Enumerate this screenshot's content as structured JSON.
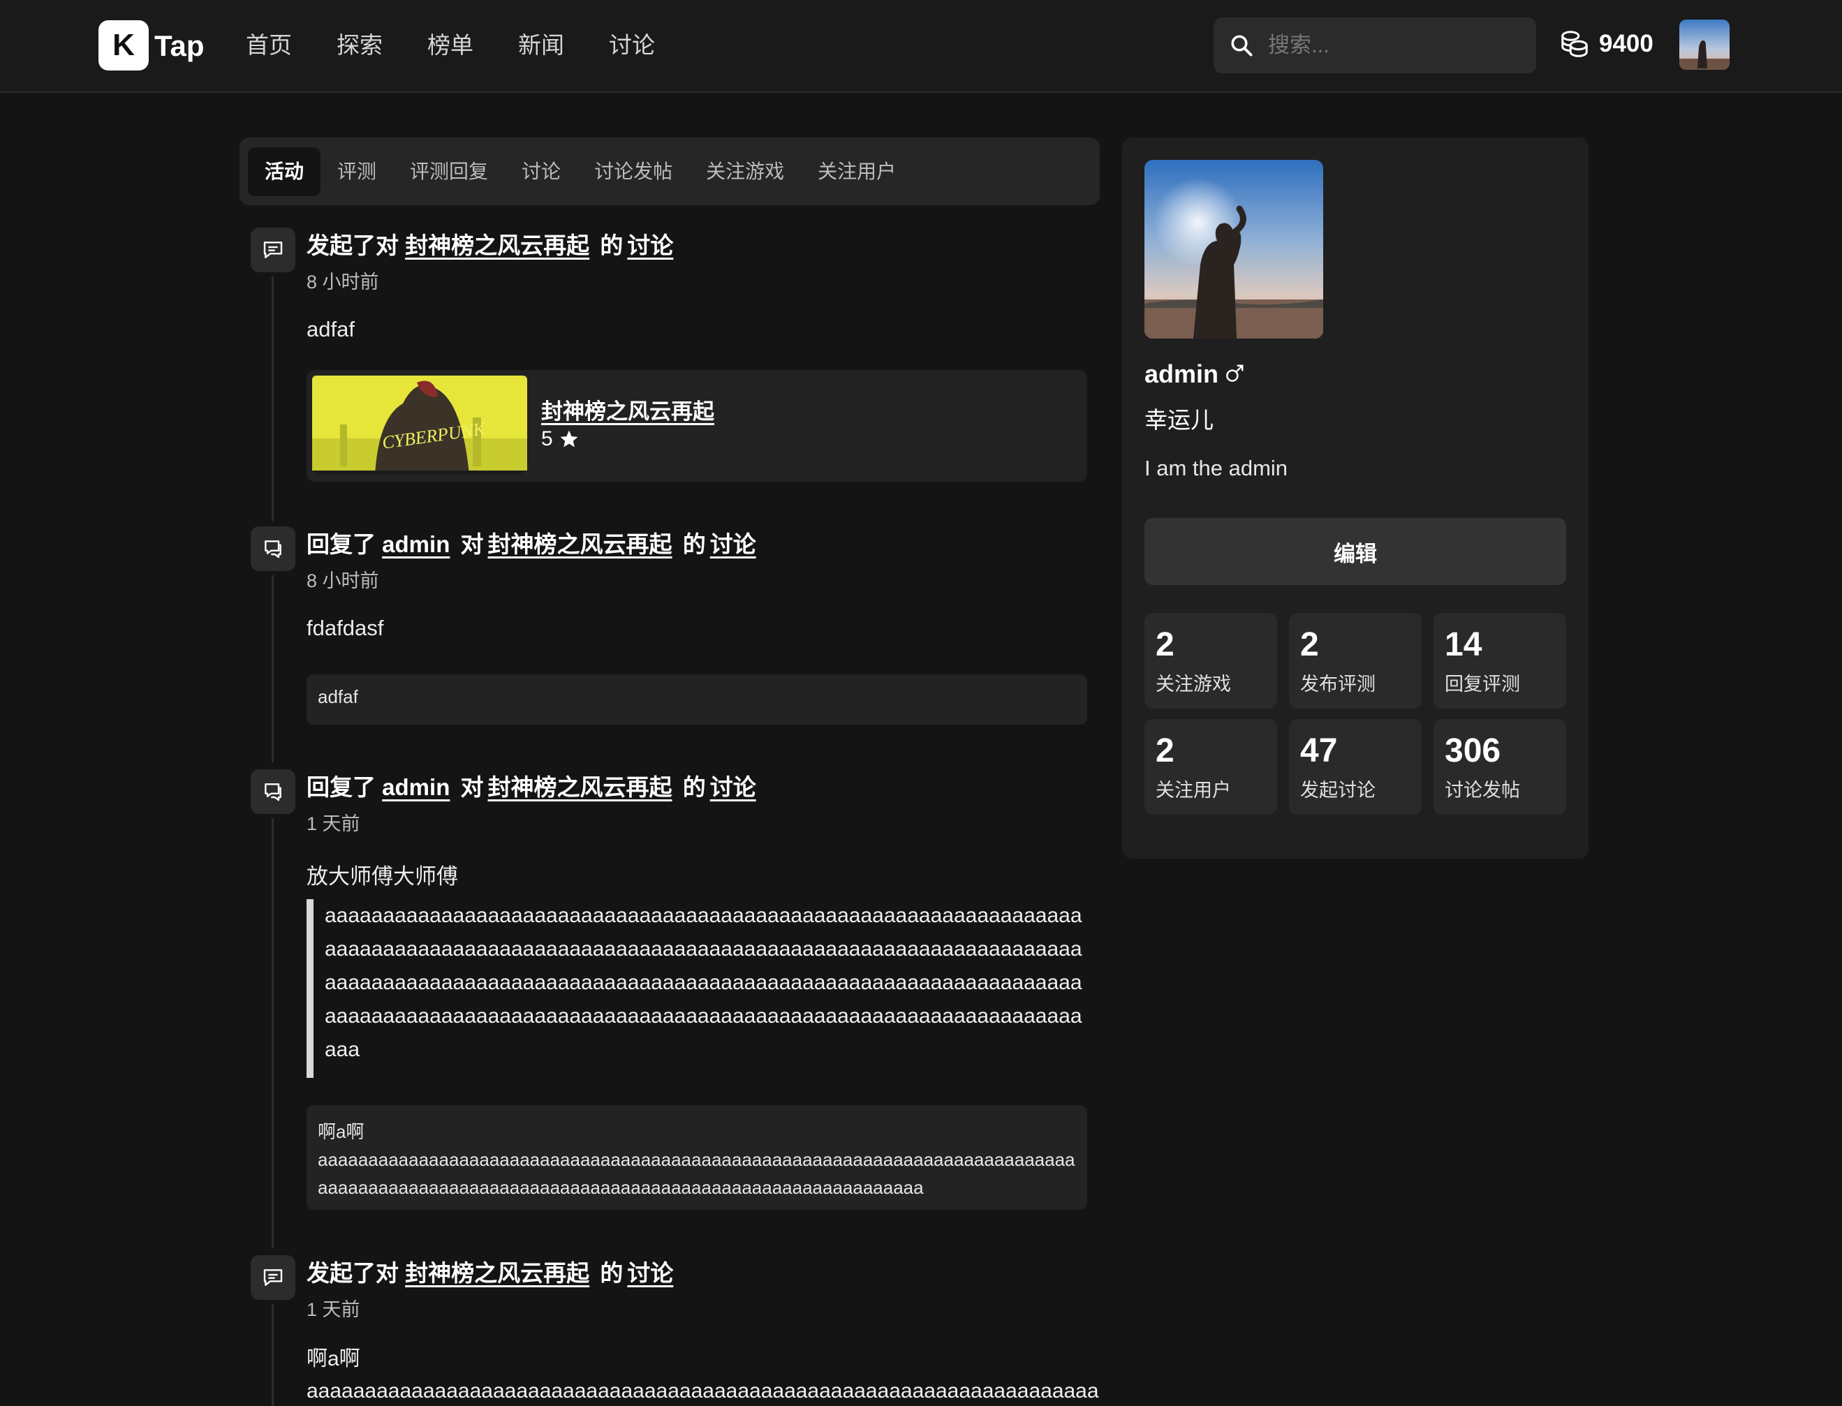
{
  "header": {
    "logo_letter": "K",
    "logo_text": "Tap",
    "nav": [
      "首页",
      "探索",
      "榜单",
      "新闻",
      "讨论"
    ],
    "search_placeholder": "搜索...",
    "coins": "9400"
  },
  "tabs": [
    "活动",
    "评测",
    "评测回复",
    "讨论",
    "讨论发帖",
    "关注游戏",
    "关注用户"
  ],
  "activities": [
    {
      "icon": "chat-bubble-icon",
      "prefix": "发起了对",
      "game": "封神榜之风云再起",
      "of": "的",
      "target": "讨论",
      "time": "8 小时前",
      "body": "adfaf",
      "card": {
        "name": "封神榜之风云再起",
        "score": "5"
      }
    },
    {
      "icon": "chat-reply-icon",
      "prefix": "回复了",
      "user": "admin",
      "to": "对",
      "game": "封神榜之风云再起",
      "of": "的",
      "target": "讨论",
      "time": "8 小时前",
      "body": "fdafdasf",
      "quote": "adfaf"
    },
    {
      "icon": "chat-reply-icon",
      "prefix": "回复了",
      "user": "admin",
      "to": "对",
      "game": "封神榜之风云再起",
      "of": "的",
      "target": "讨论",
      "time": "1 天前",
      "body": "放大师傅大师傅",
      "blockquote": "aaaaaaaaaaaaaaaaaaaaaaaaaaaaaaaaaaaaaaaaaaaaaaaaaaaaaaaaaaaaaaaaaaaaaaaaaaaaaaaaaaaaaaaaaaaaaaaaaaaaaaaaaaaaaaaaaaaaaaaaaaaaaaaaaaaaaaaaaaaaaaaaaaaaaaaaaaaaaaaaaaaaaaaaaaaaaaaaaaaaaaaaaaaaaaaaaaaaaaaaaaaaaaaaaaaaaaaaaaaaaaaaaaaaaaaaaaaaaaaaaaaaaaaaaaaaaaaaaaaaaaa",
      "quote_title": "啊a啊",
      "quote_text": "aaaaaaaaaaaaaaaaaaaaaaaaaaaaaaaaaaaaaaaaaaaaaaaaaaaaaaaaaaaaaaaaaaaaaaaaaaaaaaaaaaaaaaaaaaaaaaaaaaaaaaaaaaaaaaaaaaaaaaaaaaaaaaaaaaaaaaa"
    },
    {
      "icon": "chat-bubble-icon",
      "prefix": "发起了对",
      "game": "封神榜之风云再起",
      "of": "的",
      "target": "讨论",
      "time": "1 天前",
      "body": "啊a啊",
      "body_extra": "aaaaaaaaaaaaaaaaaaaaaaaaaaaaaaaaaaaaaaaaaaaaaaaaaaaaaaaaaaaaaaaaaaaaaa"
    }
  ],
  "profile": {
    "name": "admin",
    "gender": "male",
    "title": "幸运儿",
    "bio": "I am the admin",
    "edit_label": "编辑",
    "stats": [
      {
        "value": "2",
        "label": "关注游戏"
      },
      {
        "value": "2",
        "label": "发布评测"
      },
      {
        "value": "14",
        "label": "回复评测"
      },
      {
        "value": "2",
        "label": "关注用户"
      },
      {
        "value": "47",
        "label": "发起讨论"
      },
      {
        "value": "306",
        "label": "讨论发帖"
      }
    ]
  },
  "colors": {
    "background": "#141414",
    "header": "#1a1a1a",
    "card": "#1f1f1f",
    "accent": "#ffffff"
  }
}
